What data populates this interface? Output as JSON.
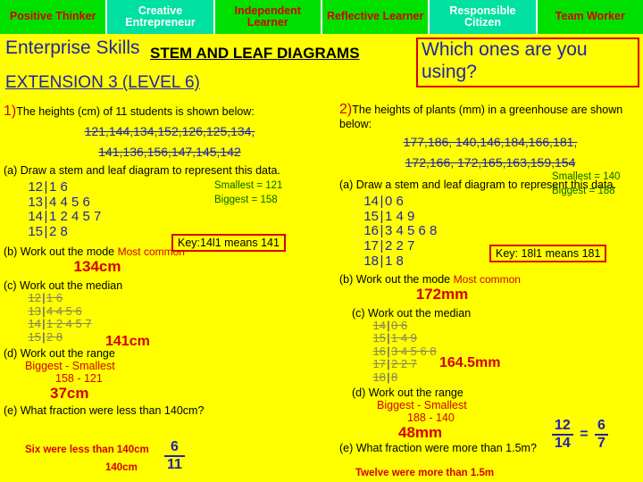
{
  "tabs": [
    {
      "label": "Positive Thinker"
    },
    {
      "label": "Creative Entrepreneur"
    },
    {
      "label": "Independent Learner"
    },
    {
      "label": "Reflective Learner"
    },
    {
      "label": "Responsible Citizen"
    },
    {
      "label": "Team Worker"
    }
  ],
  "headings": {
    "enterprise_skills": "Enterprise Skills",
    "stem_title": "STEM AND LEAF DIAGRAMS",
    "extension": "EXTENSION 3 (LEVEL 6)",
    "which_ones": "Which ones are you using?"
  },
  "q1": {
    "number": "1)",
    "text": "The heights (cm) of 11 students is shown below:",
    "data_line1": "121,144,134,152,126,125,134,",
    "data_line2": "141,136,156,147,145,142",
    "parts": {
      "a": "(a)  Draw a stem and leaf diagram to represent this data.",
      "b": "(b) Work out the mode",
      "c": "(c) Work out the median",
      "d": "(d) Work out the range",
      "e": "(e) What fraction were less than 140cm?"
    },
    "smallest": "Smallest = 121",
    "biggest": "Biggest = 158",
    "key": "Key:14l1 means 141",
    "stemleaf": [
      {
        "stem": "12",
        "leaves": "1 6"
      },
      {
        "stem": "13",
        "leaves": "4 4 5 6"
      },
      {
        "stem": "14",
        "leaves": "1 2 4 5 7"
      },
      {
        "stem": "15",
        "leaves": "2 8"
      }
    ],
    "mode_note": "Most common",
    "mode_value": "134cm",
    "median_workings": [
      {
        "stem": "12",
        "leaves": "1 6"
      },
      {
        "stem": "13",
        "leaves": "4 4 5 6"
      },
      {
        "stem": "14",
        "leaves": "1 2 4 5 7"
      },
      {
        "stem": "15",
        "leaves": "2 8"
      }
    ],
    "median_value": "141cm",
    "range_label": "Biggest - Smallest",
    "range_calc": "158 - 121",
    "range_value": "37cm",
    "fraction_note": "Six were less than 140cm",
    "fraction_num": "6",
    "fraction_den": "11"
  },
  "q2": {
    "number": "2)",
    "text": "The heights of plants (mm) in a greenhouse are shown below:",
    "data_line1": "177,186, 140,146,184,166,181,",
    "data_line2": "172,166, 172,165,163,159,154",
    "parts": {
      "a": "(a)  Draw a stem and leaf diagram to represent this data.",
      "b": "(b) Work out the mode",
      "c": "(c) Work out the median",
      "d": "(d) Work out the range",
      "e": "(e) What fraction were more than 1.5m?"
    },
    "smallest": "Smallest = 140",
    "biggest": "Biggest = 188",
    "key": "Key: 18l1 means 181",
    "stemleaf": [
      {
        "stem": "14",
        "leaves": "0 6"
      },
      {
        "stem": "15",
        "leaves": "1 4 9"
      },
      {
        "stem": "16",
        "leaves": "3 4 5 6 8"
      },
      {
        "stem": "17",
        "leaves": "2 2 7"
      },
      {
        "stem": "18",
        "leaves": "1 8"
      }
    ],
    "mode_note": "Most common",
    "mode_value": "172mm",
    "median_workings": [
      {
        "stem": "14",
        "leaves": "0 6"
      },
      {
        "stem": "15",
        "leaves": "1 4 9"
      },
      {
        "stem": "16",
        "leaves": "3 4 5 6 8"
      },
      {
        "stem": "17",
        "leaves": "2 2 7"
      },
      {
        "stem": "18",
        "leaves": "8"
      }
    ],
    "median_value": "164.5mm",
    "range_label": "Biggest - Smallest",
    "range_calc": "188 - 140",
    "range_value": "48mm",
    "fraction_note": "Twelve were more than 1.5m",
    "fraction_num": "12",
    "fraction_den": "14",
    "fraction_eq": "=",
    "fraction_num2": "6",
    "fraction_den2": "7"
  }
}
